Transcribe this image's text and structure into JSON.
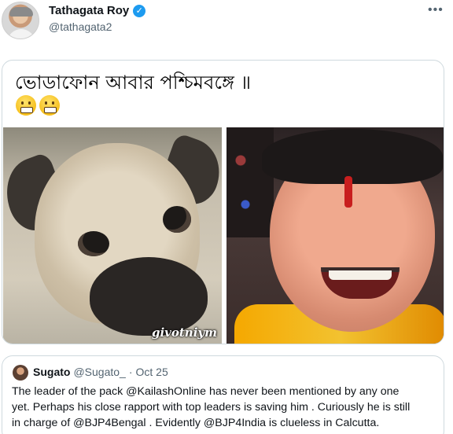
{
  "tweet": {
    "author": {
      "display_name": "Tathagata Roy",
      "handle": "@tathagata2",
      "verified_glyph": "✓"
    },
    "more_glyph": "•••",
    "media": {
      "bengali_text": "ভোডাফোন আবার পশ্চিমবঙ্গে ॥",
      "emojis": [
        "grimace-icon",
        "grimace-icon"
      ],
      "left_image_watermark": "givotniym"
    },
    "quote": {
      "author_name": "Sugato",
      "author_handle": "@Sugato_",
      "separator": "·",
      "date": "Oct 25",
      "lines": [
        "The leader of the pack @KailashOnline has never been mentioned by any one",
        "yet. Perhaps his close rapport with top leaders is saving him . Curiously he is still",
        "in charge of @BJP4Bengal . Evidently @BJP4India is clueless in Calcutta."
      ]
    }
  },
  "colors": {
    "verified": "#1d9bf0",
    "secondary_text": "#536471",
    "border": "#cfd9de"
  }
}
